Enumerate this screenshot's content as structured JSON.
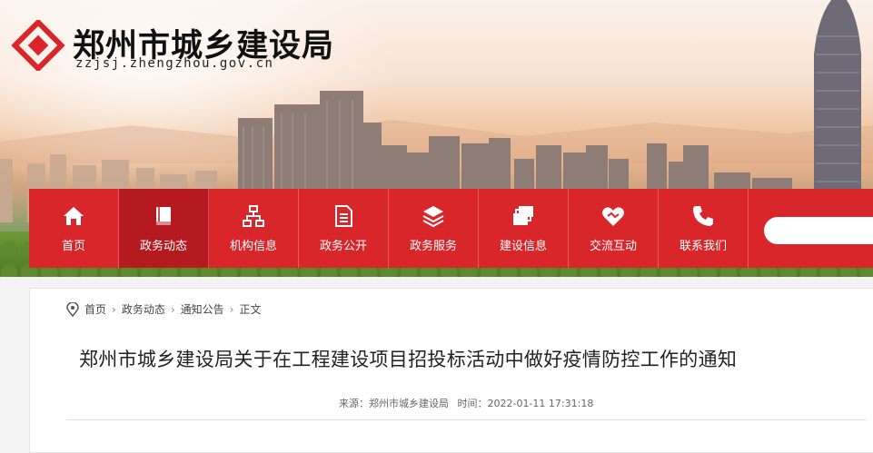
{
  "header": {
    "site_title": "郑州市城乡建设局",
    "site_domain": "zzjsj.zhengzhou.gov.cn",
    "brand_color": "#d8262b"
  },
  "nav": {
    "items": [
      {
        "label": "首页",
        "icon": "home-icon"
      },
      {
        "label": "政务动态",
        "icon": "book-icon",
        "active": true
      },
      {
        "label": "机构信息",
        "icon": "org-chart-icon"
      },
      {
        "label": "政务公开",
        "icon": "document-icon"
      },
      {
        "label": "政务服务",
        "icon": "layers-icon"
      },
      {
        "label": "建设信息",
        "icon": "stack-icon"
      },
      {
        "label": "交流互动",
        "icon": "handshake-heart-icon"
      },
      {
        "label": "联系我们",
        "icon": "phone-icon"
      }
    ],
    "search_placeholder": ""
  },
  "breadcrumb": [
    "首页",
    "政务动态",
    "通知公告",
    "正文"
  ],
  "article": {
    "title": "郑州市城乡建设局关于在工程建设项目招投标活动中做好疫情防控工作的通知",
    "source": "来源：郑州市城乡建设局",
    "time": "时间：2022-01-11 17:31:18"
  }
}
